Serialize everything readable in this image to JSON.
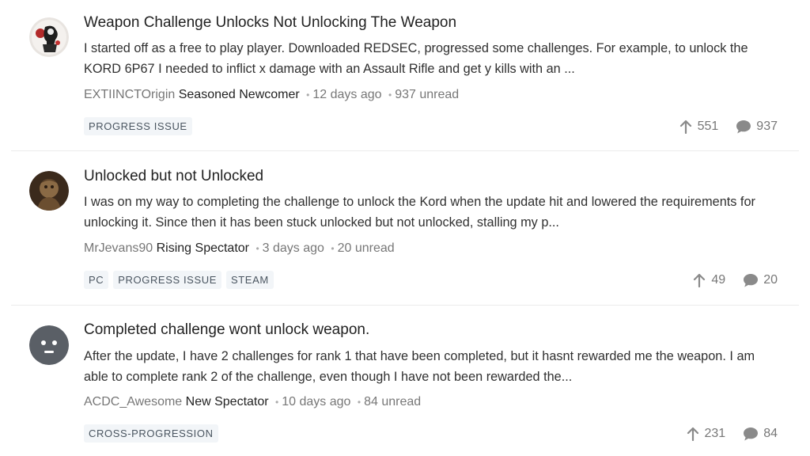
{
  "topics": [
    {
      "title": "Weapon Challenge Unlocks Not Unlocking The Weapon",
      "excerpt": "I started off as a free to play player. Downloaded REDSEC, progressed some challenges. For example, to unlock the KORD 6P67 I needed to inflict x damage with an Assault Rifle and get y kills with an ...",
      "author": "EXTIINCTOrigin",
      "rank": "Seasoned Newcomer",
      "time": "12 days ago",
      "unread": "937 unread",
      "tags": [
        "PROGRESS ISSUE"
      ],
      "upvotes": "551",
      "replies": "937",
      "avatar": "photo-avatar-dark"
    },
    {
      "title": "Unlocked but not Unlocked",
      "excerpt": "I was on my way to completing the challenge to unlock the Kord when the update hit and lowered the requirements for unlocking it. Since then it has been stuck unlocked but not unlocked, stalling my p...",
      "author": "MrJevans90",
      "rank": "Rising Spectator",
      "time": "3 days ago",
      "unread": "20 unread",
      "tags": [
        "PC",
        "PROGRESS ISSUE",
        "STEAM"
      ],
      "upvotes": "49",
      "replies": "20",
      "avatar": "photo-avatar-brown"
    },
    {
      "title": "Completed challenge wont unlock weapon.",
      "excerpt": "After the update, I have 2 challenges for rank 1 that have been completed, but it hasnt rewarded me the weapon. I am able to complete rank 2 of the challenge, even though I have not been rewarded the...",
      "author": "ACDC_Awesome",
      "rank": "New Spectator",
      "time": "10 days ago",
      "unread": "84 unread",
      "tags": [
        "CROSS-PROGRESSION"
      ],
      "upvotes": "231",
      "replies": "84",
      "avatar": "default-face-avatar"
    }
  ],
  "icons": {
    "upvote": "arrow-up-icon",
    "replies": "speech-bubble-icon"
  },
  "colors": {
    "tag_bg": "#f2f5f8",
    "tag_text": "#4a5560",
    "meta_text": "#777777",
    "default_avatar": "#5a5f66"
  }
}
